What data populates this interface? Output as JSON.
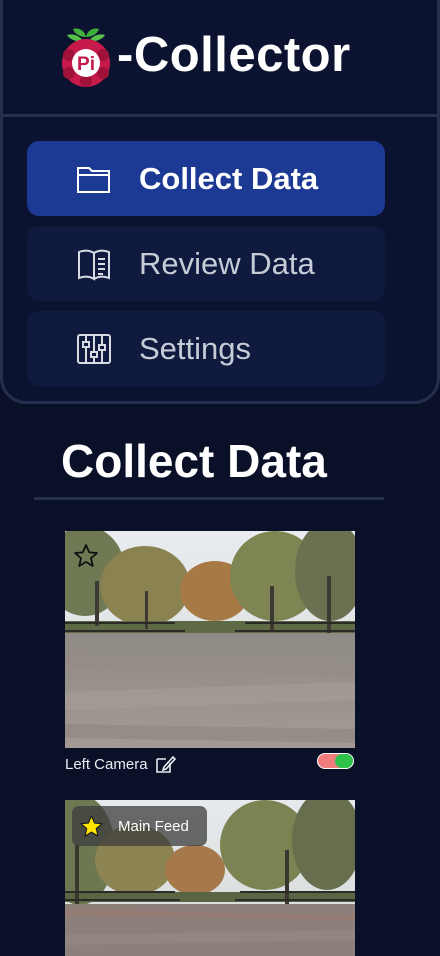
{
  "app": {
    "logo_text": "Pi",
    "title": "-Collector"
  },
  "nav": {
    "items": [
      {
        "label": "Collect Data",
        "icon": "folder-icon",
        "active": true
      },
      {
        "label": "Review Data",
        "icon": "book-icon",
        "active": false
      },
      {
        "label": "Settings",
        "icon": "sliders-icon",
        "active": false
      }
    ]
  },
  "page": {
    "title": "Collect Data"
  },
  "feeds": [
    {
      "caption": "Left Camera",
      "starred": false,
      "toggle_on": true
    },
    {
      "badge": "Main Feed",
      "starred": true
    }
  ],
  "colors": {
    "background": "#0a1027",
    "panel": "#0b1330",
    "nav_active": "#1c3a93",
    "nav_item": "#0f1a3e",
    "toggle_off": "#f07c7c",
    "toggle_on": "#2fc24b",
    "star": "#ffe600"
  }
}
